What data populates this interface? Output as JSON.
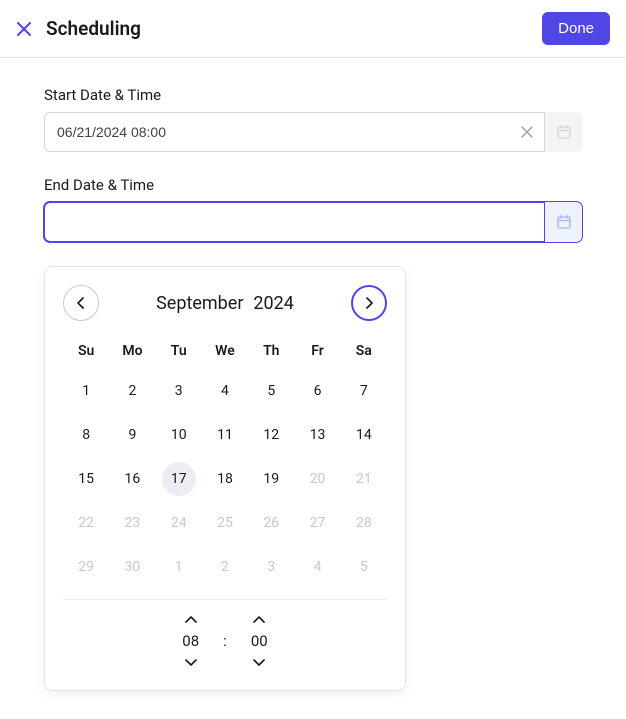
{
  "header": {
    "title": "Scheduling",
    "done_label": "Done"
  },
  "form": {
    "start_label": "Start Date & Time",
    "start_value": "06/21/2024 08:00",
    "end_label": "End Date & Time",
    "end_value": ""
  },
  "calendar": {
    "month": "September",
    "year": "2024",
    "dow": [
      "Su",
      "Mo",
      "Tu",
      "We",
      "Th",
      "Fr",
      "Sa"
    ],
    "days": [
      {
        "n": "1",
        "d": false,
        "c": false
      },
      {
        "n": "2",
        "d": false,
        "c": false
      },
      {
        "n": "3",
        "d": false,
        "c": false
      },
      {
        "n": "4",
        "d": false,
        "c": false
      },
      {
        "n": "5",
        "d": false,
        "c": false
      },
      {
        "n": "6",
        "d": false,
        "c": false
      },
      {
        "n": "7",
        "d": false,
        "c": false
      },
      {
        "n": "8",
        "d": false,
        "c": false
      },
      {
        "n": "9",
        "d": false,
        "c": false
      },
      {
        "n": "10",
        "d": false,
        "c": false
      },
      {
        "n": "11",
        "d": false,
        "c": false
      },
      {
        "n": "12",
        "d": false,
        "c": false
      },
      {
        "n": "13",
        "d": false,
        "c": false
      },
      {
        "n": "14",
        "d": false,
        "c": false
      },
      {
        "n": "15",
        "d": false,
        "c": false
      },
      {
        "n": "16",
        "d": false,
        "c": false
      },
      {
        "n": "17",
        "d": false,
        "c": true
      },
      {
        "n": "18",
        "d": false,
        "c": false
      },
      {
        "n": "19",
        "d": false,
        "c": false
      },
      {
        "n": "20",
        "d": true,
        "c": false
      },
      {
        "n": "21",
        "d": true,
        "c": false
      },
      {
        "n": "22",
        "d": true,
        "c": false
      },
      {
        "n": "23",
        "d": true,
        "c": false
      },
      {
        "n": "24",
        "d": true,
        "c": false
      },
      {
        "n": "25",
        "d": true,
        "c": false
      },
      {
        "n": "26",
        "d": true,
        "c": false
      },
      {
        "n": "27",
        "d": true,
        "c": false
      },
      {
        "n": "28",
        "d": true,
        "c": false
      },
      {
        "n": "29",
        "d": true,
        "c": false
      },
      {
        "n": "30",
        "d": true,
        "c": false
      },
      {
        "n": "1",
        "d": true,
        "c": false
      },
      {
        "n": "2",
        "d": true,
        "c": false
      },
      {
        "n": "3",
        "d": true,
        "c": false
      },
      {
        "n": "4",
        "d": true,
        "c": false
      },
      {
        "n": "5",
        "d": true,
        "c": false
      }
    ],
    "time": {
      "hour": "08",
      "minute": "00",
      "sep": ":"
    }
  }
}
